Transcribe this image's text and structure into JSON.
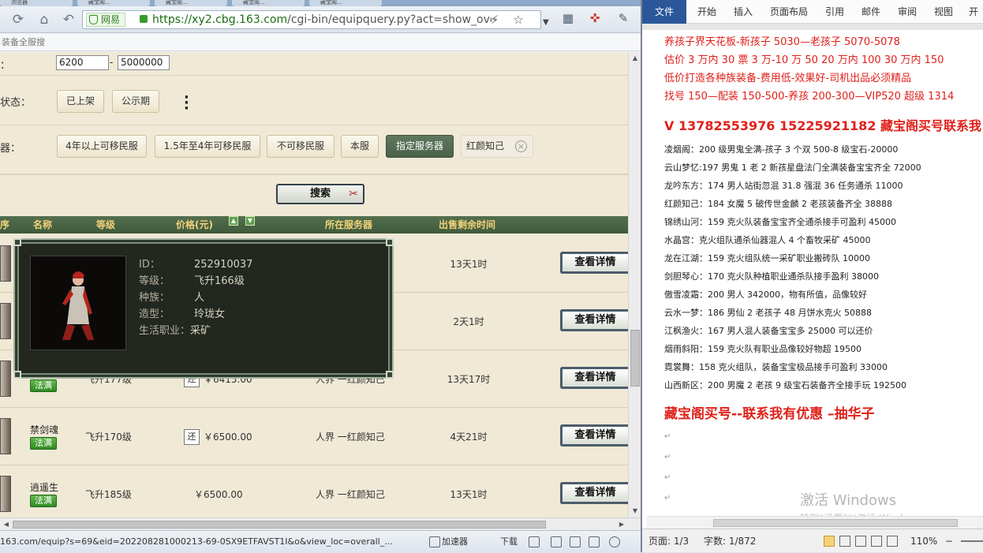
{
  "browser": {
    "tabs": [
      {
        "label": "浏览器"
      },
      {
        "label": "藏宝阁..."
      },
      {
        "label": "藏宝阁..."
      },
      {
        "label": "藏宝阁..."
      },
      {
        "label": "藏宝阁..."
      }
    ],
    "site_badge": "网易",
    "url_host": "https://xy2.cbg.163.com",
    "url_path": "/cgi-bin/equipquery.py?act=show_ove",
    "bookmark_text": "装备全服搜",
    "status_url": "163.com/equip?s=69&eid=202208281000213-69-0SX9ETFAVST1I&o&view_loc=overall_...",
    "status_items": {
      "accelerator": "加速器",
      "download": "下载"
    }
  },
  "filters": {
    "price_label": "：",
    "price_min": "6200",
    "price_max": "5000000",
    "status_label": "状态：",
    "status_options": [
      "已上架",
      "公示期"
    ],
    "server_label": "器：",
    "server_options": [
      "4年以上可移民服",
      "1.5年至4年可移民服",
      "不可移民服",
      "本服",
      "指定服务器"
    ],
    "server_active": "指定服务器",
    "server_selected": "红颜知己",
    "search_label": "搜索"
  },
  "table": {
    "headers": {
      "index": "序",
      "name": "名称",
      "level": "等级",
      "price": "价格(元)",
      "server": "所在服务器",
      "time": "出售剩余时间"
    },
    "rows": [
      {
        "name": "",
        "badge": "",
        "level": "",
        "huan": "",
        "price": "",
        "server": "",
        "time": "13天1时",
        "detail": "查看详情"
      },
      {
        "name": "",
        "badge": "",
        "level": "",
        "huan": "",
        "price": "",
        "server": "",
        "time": "2天1时",
        "detail": "查看详情"
      },
      {
        "name": "",
        "badge": "法满",
        "level": "飞升177级",
        "huan": "还",
        "price": "￥6415.00",
        "server": "人界 一红颜知己",
        "time": "13天17时",
        "detail": "查看详情"
      },
      {
        "name": "禁剑魂",
        "badge": "法满",
        "level": "飞升170级",
        "huan": "还",
        "price": "￥6500.00",
        "server": "人界 一红颜知己",
        "time": "4天21时",
        "detail": "查看详情"
      },
      {
        "name": "逍遥生",
        "badge": "法满",
        "level": "飞升185级",
        "huan": "",
        "price": "￥6500.00",
        "server": "人界 一红颜知己",
        "time": "13天1时",
        "detail": "查看详情"
      }
    ]
  },
  "tooltip": {
    "id_label": "ID：",
    "id_value": "252910037",
    "level_label": "等级：",
    "level_value": "飞升166级",
    "race_label": "种族：",
    "race_value": "人",
    "model_label": "造型：",
    "model_value": "玲珑女",
    "job_label": "生活职业：",
    "job_value": "采矿"
  },
  "word": {
    "file_tab": "文件",
    "tabs": [
      "开始",
      "插入",
      "页面布局",
      "引用",
      "邮件",
      "审阅",
      "视图",
      "开发"
    ],
    "lines_red": [
      "养孩子界天花板-新孩子 5030—老孩子 5070-5078",
      "估价 3 万内 30 票  3 万-10 万 50  20 万内 100  30 万内 150",
      "低价打造各种族装备-费用低-效果好-司机出品必须精品",
      "找号 150—配装 150-500-养孩 200-300—VIP520 超级 1314"
    ],
    "phone_line": "V 13782553976   15225921182  藏宝阁买号联系我",
    "list": [
      "凌烟阁：200 级男鬼全满-孩子 3 个双 500-8 级宝石-20000",
      "云山梦忆:197 男鬼 1 老 2 新孩星盘法门全满装备宝宝齐全 72000",
      "龙吟东方：174 男人站街忽混 31.8 强混 36 任务通杀 11000",
      "红颜知己：184 女魔 5 破传世金麟 2 老孩装备齐全 38888",
      "锦绣山河：159 克火队装备宝宝齐全通杀接手可盈利 45000",
      "水晶宫：克火组队通杀仙器混人 4 个畜牧采矿 45000",
      "龙在江湖：159 克火组队统一采矿职业搬砖队 10000",
      "剑胆琴心：170 克火队种植职业通杀队接手盈利 38000",
      "傲雪凌霜：200 男人 342000，物有所值，品像较好",
      "云水一梦：186 男仙 2 老孩子 48 月饼水克火 50888",
      "江枫渔火：167 男人混人装备宝宝多 25000 可以还价",
      "烟雨斜阳：159 克火队有职业品像较好物超 19500",
      "霓裳舞：158 克火组队，装备宝宝极品接手可盈利 33000",
      "山西新区：200 男魔 2 老孩 9 级宝石装备齐全接手玩 192500"
    ],
    "footer_line": "藏宝阁买号--联系我有优惠 –抽华子",
    "watermark": "激活 Windows",
    "watermark_sub": "转到“设置”以激活 Windows。",
    "status_page": "页面: 1/3",
    "status_words": "字数: 1/872",
    "zoom": "110%"
  }
}
